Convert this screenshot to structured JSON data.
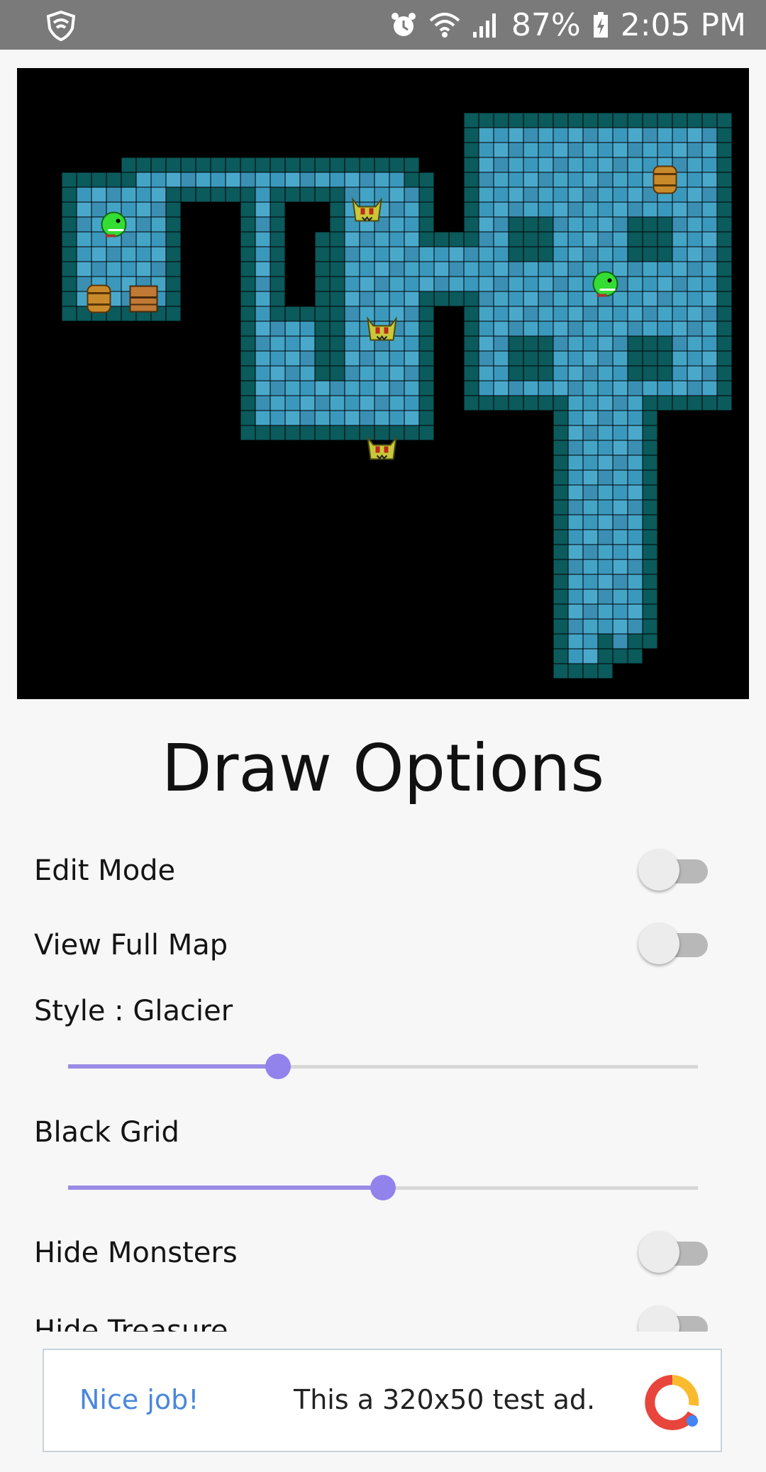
{
  "status_bar": {
    "battery": "87%",
    "time": "2:05 PM",
    "icons": [
      "shield-icon",
      "alarm-icon",
      "wifi-icon",
      "signal-icon",
      "battery-charging-icon"
    ]
  },
  "map": {
    "style": "Glacier",
    "sprites": [
      "green-dragon",
      "barrel",
      "treasure-chest",
      "orc",
      "orc",
      "orc",
      "barrel",
      "green-dragon"
    ]
  },
  "draw_options": {
    "title": "Draw Options",
    "edit_mode": {
      "label": "Edit Mode",
      "on": false
    },
    "view_full_map": {
      "label": "View Full Map",
      "on": false
    },
    "style": {
      "label": "Style : Glacier",
      "value_fraction": 0.333
    },
    "grid": {
      "label": "Black Grid",
      "value_fraction": 0.5
    },
    "hide_monsters": {
      "label": "Hide Monsters",
      "on": false
    },
    "hide_treasure": {
      "label": "Hide Treasure",
      "on": false
    }
  },
  "ad": {
    "headline": "Nice job!",
    "message": "This a 320x50 test ad."
  },
  "colors": {
    "accent": "#9182ec",
    "status_bar": "#7a7a7a",
    "ad_headline": "#4a87dc"
  }
}
